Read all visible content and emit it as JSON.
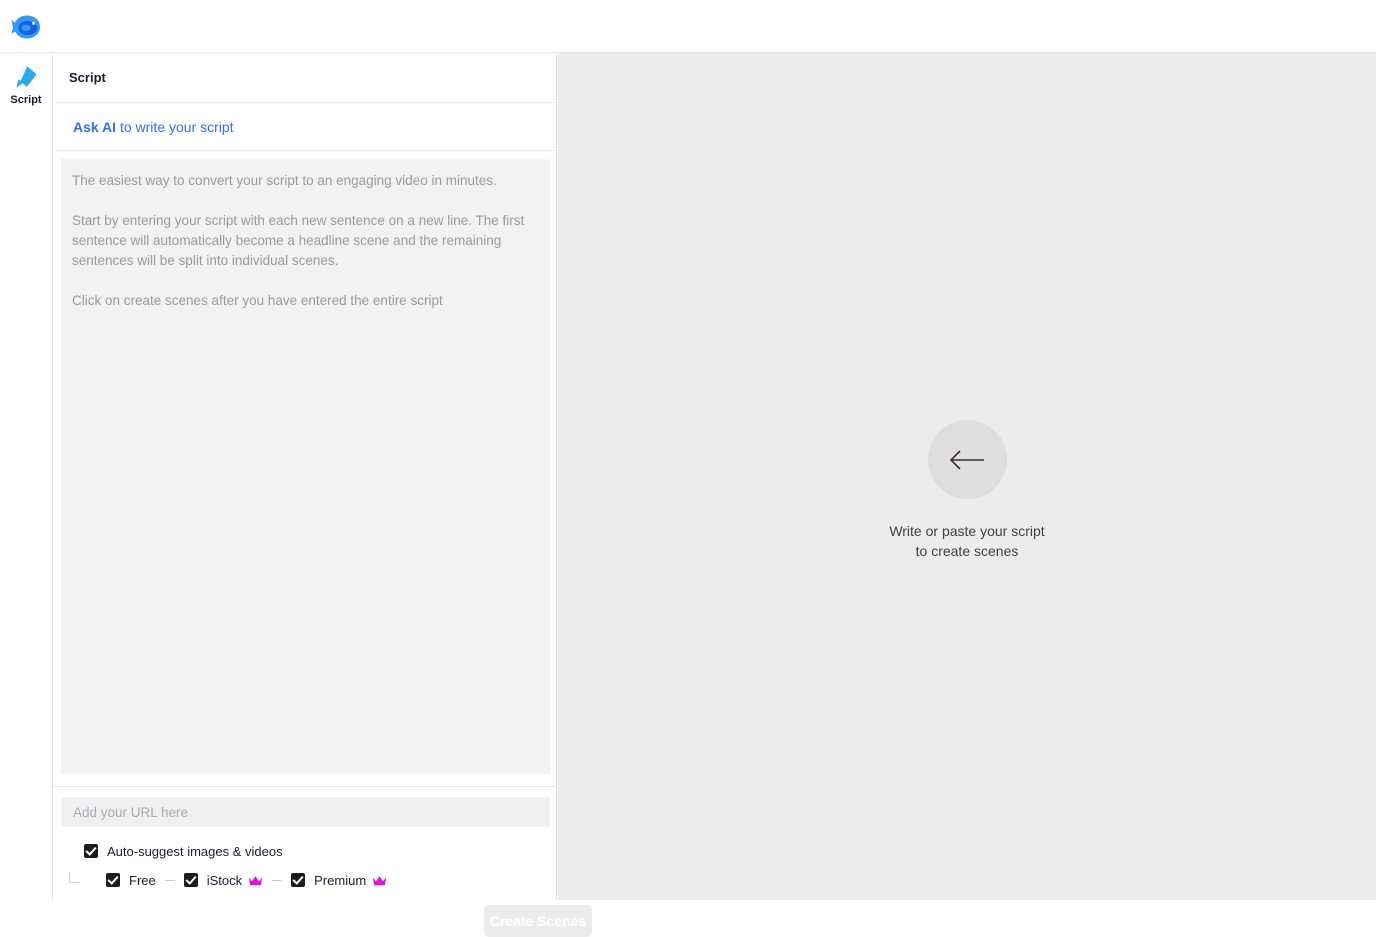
{
  "app": {
    "logo_icon": "fish-logo-icon",
    "brand_color": "#1f8cf0"
  },
  "sidebar": {
    "items": [
      {
        "label": "Script",
        "icon": "script-diamond-icon",
        "active": true
      }
    ]
  },
  "panel": {
    "title": "Script",
    "ask_ai": {
      "bold_text": "Ask AI",
      "rest_text": " to write your script"
    },
    "script_editor": {
      "value": "",
      "placeholder": "The easiest way to convert your script to an engaging video in minutes.\n\nStart by entering your script with each new sentence on a new line. The first sentence will automatically become a headline scene and the remaining sentences will be split into individual scenes.\n\nClick on create scenes after you have entered the entire script"
    },
    "url_field": {
      "value": "",
      "placeholder": "Add your URL here"
    },
    "options": {
      "auto_suggest": {
        "label": "Auto-suggest images & videos",
        "checked": true
      },
      "sources": [
        {
          "label": "Free",
          "checked": true,
          "premium_icon": false
        },
        {
          "label": "iStock",
          "checked": true,
          "premium_icon": true
        },
        {
          "label": "Premium",
          "checked": true,
          "premium_icon": true
        }
      ],
      "crown_color": "#d916d9"
    },
    "create_button": {
      "label": "Create Scenes",
      "disabled": true
    }
  },
  "canvas": {
    "empty_state": {
      "icon": "arrow-left-icon",
      "line1": "Write or paste your script",
      "line2": "to create scenes"
    }
  }
}
